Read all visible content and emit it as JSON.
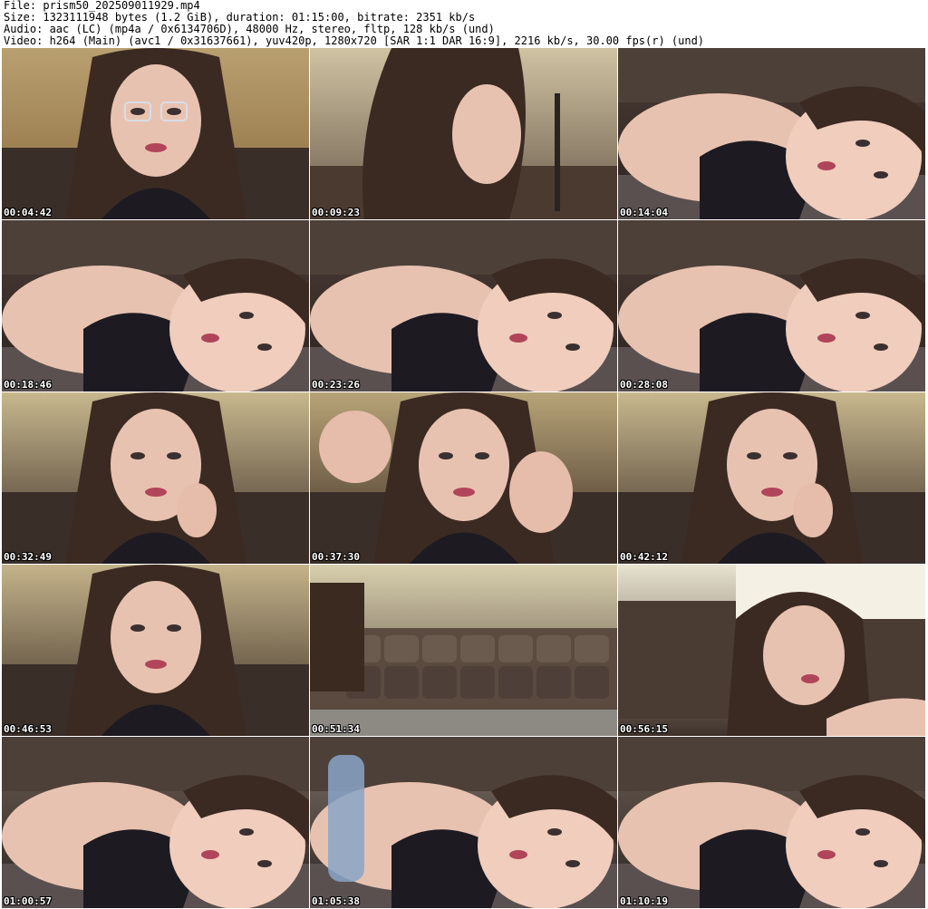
{
  "header": {
    "file_line": "File: prism50_202509011929.mp4",
    "size_line": "Size: 1323111948 bytes (1.2 GiB), duration: 01:15:00, bitrate: 2351 kb/s",
    "audio_line": "Audio: aac (LC) (mp4a / 0x6134706D), 48000 Hz, stereo, fltp, 128 kb/s (und)",
    "video_line": "Video: h264 (Main) (avc1 / 0x31637661), yuv420p, 1280x720 [SAR 1:1 DAR 16:9], 2216 kb/s, 30.00 fps(r) (und)"
  },
  "thumbnails": [
    {
      "timestamp": "00:04:42",
      "scene": "webcam-portrait-glasses"
    },
    {
      "timestamp": "00:09:23",
      "scene": "webcam-profile-looking-down"
    },
    {
      "timestamp": "00:14:04",
      "scene": "webcam-lying-on-floor"
    },
    {
      "timestamp": "00:18:46",
      "scene": "webcam-lying-on-floor"
    },
    {
      "timestamp": "00:23:26",
      "scene": "webcam-lying-on-floor"
    },
    {
      "timestamp": "00:28:08",
      "scene": "webcam-lying-on-floor"
    },
    {
      "timestamp": "00:32:49",
      "scene": "webcam-chin-on-hand"
    },
    {
      "timestamp": "00:37:30",
      "scene": "webcam-gesturing-hands"
    },
    {
      "timestamp": "00:42:12",
      "scene": "webcam-chin-on-hand"
    },
    {
      "timestamp": "00:46:53",
      "scene": "webcam-close-portrait"
    },
    {
      "timestamp": "00:51:34",
      "scene": "empty-room-sofa"
    },
    {
      "timestamp": "00:56:15",
      "scene": "webcam-reclining-on-sofa"
    },
    {
      "timestamp": "01:00:57",
      "scene": "webcam-lying-close"
    },
    {
      "timestamp": "01:05:38",
      "scene": "webcam-lying-with-bottle"
    },
    {
      "timestamp": "01:10:19",
      "scene": "webcam-lying-close"
    }
  ]
}
